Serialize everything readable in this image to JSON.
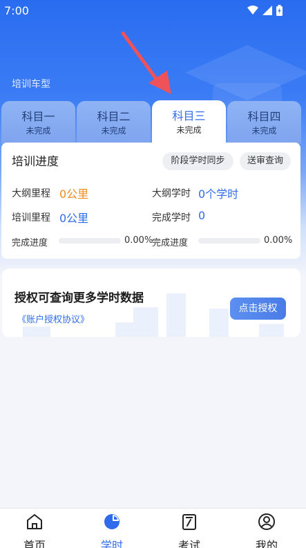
{
  "status_bar": {
    "time": "7:00"
  },
  "header": {
    "car_type_label": "培训车型"
  },
  "subject_tabs": [
    {
      "name": "科目一",
      "status": "未完成",
      "active": false
    },
    {
      "name": "科目二",
      "status": "未完成",
      "active": false
    },
    {
      "name": "科目三",
      "status": "未完成",
      "active": true
    },
    {
      "name": "科目四",
      "status": "未完成",
      "active": false
    }
  ],
  "progress": {
    "title": "培训进度",
    "sync_button": "阶段学时同步",
    "review_button": "送审查询",
    "outline_mileage_label": "大纲里程",
    "outline_mileage_value": "0公里",
    "outline_hours_label": "大纲学时",
    "outline_hours_value": "0个学时",
    "training_mileage_label": "培训里程",
    "training_mileage_value": "0公里",
    "completed_hours_label": "完成学时",
    "completed_hours_value": "0",
    "progress_left_label": "完成进度",
    "progress_left_value": "0.00%",
    "progress_left_fraction": 0,
    "progress_right_label": "完成进度",
    "progress_right_value": "0.00%",
    "progress_right_fraction": 0
  },
  "auth": {
    "title": "授权可查询更多学时数据",
    "agreement_link": "《账户授权协议》",
    "button": "点击授权"
  },
  "bottom_nav": [
    {
      "label": "首页",
      "icon": "home-icon",
      "active": false
    },
    {
      "label": "学时",
      "icon": "pie-chart-icon",
      "active": true
    },
    {
      "label": "考试",
      "icon": "exam-icon",
      "active": false
    },
    {
      "label": "我的",
      "icon": "user-icon",
      "active": false
    }
  ],
  "colors": {
    "accent": "#2f6bed",
    "orange": "#f08b1e",
    "arrow": "#f0525a"
  }
}
